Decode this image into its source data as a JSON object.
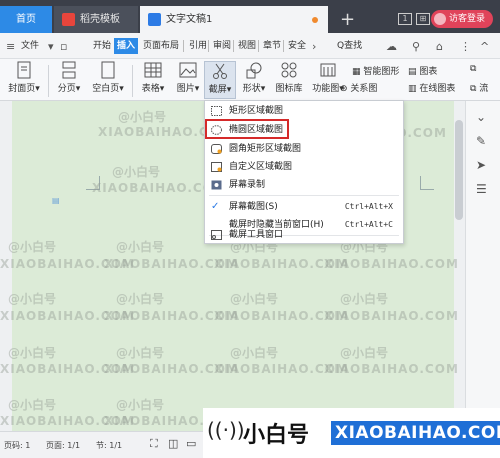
{
  "tabs": {
    "home": "首页",
    "template": "稻壳模板",
    "doc": "文字文稿1",
    "login": "访客登录"
  },
  "menu": {
    "file": "文件",
    "start": "开始",
    "insert": "插入",
    "layout": "页面布局",
    "reference": "引用",
    "review": "审阅",
    "view": "视图",
    "chapter": "章节",
    "security": "安全",
    "search": "Q查找"
  },
  "ribbon": {
    "cover": "封面页",
    "pagination": "分页",
    "blank": "空白页",
    "table": "表格",
    "picture": "图片",
    "screenshot": "截屏",
    "shape": "形状",
    "iconlib": "图标库",
    "function": "功能图",
    "smartgraphic": "智能图形",
    "chart": "图表",
    "relation": "关系图",
    "online_chart": "在线图表",
    "more": "流"
  },
  "dropdown": {
    "rect": "矩形区域截图",
    "ellipse": "椭圆区域截图",
    "round": "圆角矩形区域截图",
    "custom": "自定义区域截图",
    "record": "屏幕录制",
    "screen": "屏幕截图(S)",
    "screen_sc": "Ctrl+Alt+X",
    "hide": "截屏时隐藏当前窗口(H)",
    "hide_sc": "Ctrl+Alt+C",
    "tool": "截屏工具窗口"
  },
  "status": {
    "page_code": "页码: 1",
    "page": "页面: 1/1",
    "section": "节: 1/1"
  },
  "brand": {
    "cn": "小白号",
    "en": "XIAOBAIHAO.COM"
  },
  "watermark": {
    "cn": "@小白号",
    "en": "XIAOBAIHAO.COM"
  }
}
